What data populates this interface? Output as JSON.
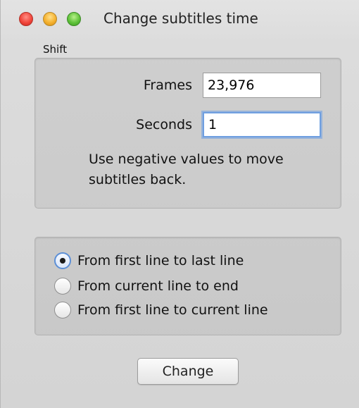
{
  "window": {
    "title": "Change subtitles time"
  },
  "shift": {
    "label": "Shift",
    "frames_label": "Frames",
    "frames_value": "23,976",
    "seconds_label": "Seconds",
    "seconds_value": "1",
    "hint": "Use negative values to move subtitles back."
  },
  "range": {
    "selected": 0,
    "options": [
      "From first line to last line",
      "From current line to end",
      "From first line to current line"
    ]
  },
  "actions": {
    "change_label": "Change"
  },
  "colors": {
    "close": "#f1463c",
    "minimize": "#f5b12f",
    "zoom": "#5fc23a",
    "focus_ring": "#6f9fe0"
  }
}
